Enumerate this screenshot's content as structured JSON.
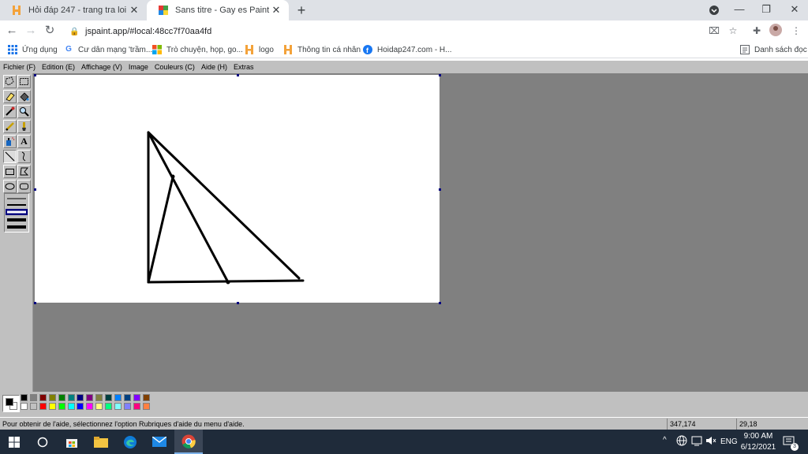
{
  "browser": {
    "tabs": [
      {
        "title": "Hỏi đáp 247 - trang tra loi",
        "active": false
      },
      {
        "title": "Sans titre - Gay es Paint",
        "active": true
      }
    ],
    "url": "jspaint.app/#local:48cc7f70aa4fd",
    "bookmarks": [
      {
        "label": "Ứng dụng",
        "icon": "apps-grid-icon"
      },
      {
        "label": "Cư dân mạng 'trầm...",
        "icon": "google-icon"
      },
      {
        "label": "Trò chuyện, họp, go...",
        "icon": "microsoft-icon"
      },
      {
        "label": "logo",
        "icon": "hoidap-icon"
      },
      {
        "label": "Thông tin cá nhân",
        "icon": "hoidap-icon"
      },
      {
        "label": "Hoidap247.com - H...",
        "icon": "facebook-icon"
      }
    ],
    "reading_list": "Danh sách đọc"
  },
  "paint": {
    "menu": [
      "Fichier (F)",
      "Edition (E)",
      "Affichage (V)",
      "Image",
      "Couleurs (C)",
      "Aide (H)",
      "Extras"
    ],
    "tools": [
      "free-form-select-icon",
      "select-icon",
      "eraser-icon",
      "fill-bucket-icon",
      "pick-color-icon",
      "magnifier-icon",
      "pencil-icon",
      "brush-icon",
      "airbrush-icon",
      "text-icon",
      "line-icon",
      "curve-icon",
      "rectangle-icon",
      "polygon-icon",
      "ellipse-icon",
      "rounded-rectangle-icon"
    ],
    "selected_tool": "line-icon",
    "palette": [
      "#000000",
      "#808080",
      "#800000",
      "#808000",
      "#008000",
      "#008080",
      "#000080",
      "#800080",
      "#808040",
      "#004040",
      "#0080ff",
      "#004080",
      "#8000ff",
      "#804000",
      "#ffffff",
      "#c0c0c0",
      "#ff0000",
      "#ffff00",
      "#00ff00",
      "#00ffff",
      "#0000ff",
      "#ff00ff",
      "#ffff80",
      "#00ff80",
      "#80ffff",
      "#8080ff",
      "#ff0080",
      "#ff8040"
    ],
    "primary_color": "#000000",
    "secondary_color": "#ffffff",
    "status_help": "Pour obtenir de l'aide, sélectionnez l'option Rubriques d'aide du menu d'aide.",
    "cursor_position": "347,174",
    "selection_size": "29,18"
  },
  "taskbar": {
    "language": "ENG",
    "time": "9:00 AM",
    "date": "6/12/2021",
    "notifications": "3"
  }
}
